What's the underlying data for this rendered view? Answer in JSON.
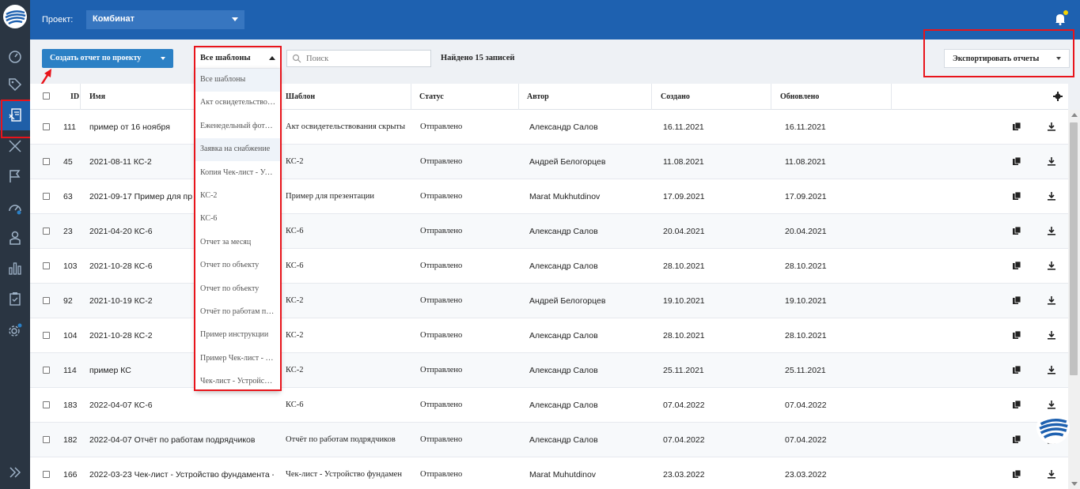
{
  "topbar": {
    "project_label": "Проект:",
    "project_value": "Комбинат"
  },
  "toolbar": {
    "create_label": "Создать отчет по проекту",
    "template_selected": "Все шаблоны",
    "search_placeholder": "Поиск",
    "found_text": "Найдено 15 записей",
    "export_label": "Экспортировать отчеты"
  },
  "table": {
    "headers": {
      "id": "ID",
      "name": "Имя",
      "template": "Шаблон",
      "status": "Статус",
      "author": "Автор",
      "created": "Создано",
      "updated": "Обновлено"
    },
    "rows": [
      {
        "id": "111",
        "name": "пример от 16 ноября",
        "template": "Акт освидетельствования скрыты",
        "status": "Отправлено",
        "author": "Александр Салов",
        "created": "16.11.2021",
        "updated": "16.11.2021"
      },
      {
        "id": "45",
        "name": "2021-08-11 КС-2",
        "template": "КС-2",
        "status": "Отправлено",
        "author": "Андрей Белогорцев",
        "created": "11.08.2021",
        "updated": "11.08.2021"
      },
      {
        "id": "63",
        "name": "2021-09-17 Пример для пр",
        "template": "Пример для презентации",
        "status": "Отправлено",
        "author": "Marat Mukhutdinov",
        "created": "17.09.2021",
        "updated": "17.09.2021"
      },
      {
        "id": "23",
        "name": "2021-04-20 КС-6",
        "template": "КС-6",
        "status": "Отправлено",
        "author": "Александр Салов",
        "created": "20.04.2021",
        "updated": "20.04.2021"
      },
      {
        "id": "103",
        "name": "2021-10-28 КС-6",
        "template": "КС-6",
        "status": "Отправлено",
        "author": "Александр Салов",
        "created": "28.10.2021",
        "updated": "28.10.2021"
      },
      {
        "id": "92",
        "name": "2021-10-19 КС-2",
        "template": "КС-2",
        "status": "Отправлено",
        "author": "Андрей Белогорцев",
        "created": "19.10.2021",
        "updated": "19.10.2021"
      },
      {
        "id": "104",
        "name": "2021-10-28 КС-2",
        "template": "КС-2",
        "status": "Отправлено",
        "author": "Александр Салов",
        "created": "28.10.2021",
        "updated": "28.10.2021"
      },
      {
        "id": "114",
        "name": "пример КС",
        "template": "КС-2",
        "status": "Отправлено",
        "author": "Александр Салов",
        "created": "25.11.2021",
        "updated": "25.11.2021"
      },
      {
        "id": "183",
        "name": "2022-04-07 КС-6",
        "template": "КС-6",
        "status": "Отправлено",
        "author": "Александр Салов",
        "created": "07.04.2022",
        "updated": "07.04.2022"
      },
      {
        "id": "182",
        "name": "2022-04-07 Отчёт по работам подрядчиков",
        "template": "Отчёт по работам подрядчиков",
        "status": "Отправлено",
        "author": "Александр Салов",
        "created": "07.04.2022",
        "updated": "07.04.2022"
      },
      {
        "id": "166",
        "name": "2022-03-23 Чек-лист - Устройство фундамента -",
        "template": "Чек-лист - Устройство фундамен",
        "status": "Отправлено",
        "author": "Marat Muhutdinov",
        "created": "23.03.2022",
        "updated": "23.03.2022"
      }
    ]
  },
  "dropdown": {
    "items": [
      "Все шаблоны",
      "Акт освидетельствования скрытых работ",
      "Еженедельный фотоотчет",
      "Заявка на снабжение",
      "Копия Чек-лист - Устройство",
      "КС-2",
      "КС-6",
      "Отчет за месяц",
      "Отчет по объекту",
      "Отчет по объекту",
      "Отчёт по работам подрядчиков",
      "Пример инструкции",
      "Пример Чек-лист - Устройство",
      "Чек-лист - Устройство фундамента"
    ]
  },
  "colors": {
    "topbar": "#1e61b0",
    "sidebar": "#2a3542",
    "primary_button": "#2b80c5",
    "highlight_box": "#e8141b"
  },
  "icons": [
    "dashboard-icon",
    "tag-icon",
    "reports-icon",
    "tools-icon",
    "flag-icon",
    "speed-icon",
    "user-icon",
    "chart-icon",
    "clipboard-icon",
    "settings-icon",
    "expand-icon",
    "bell-icon",
    "search-icon",
    "gear-icon",
    "copy-icon",
    "download-icon"
  ]
}
